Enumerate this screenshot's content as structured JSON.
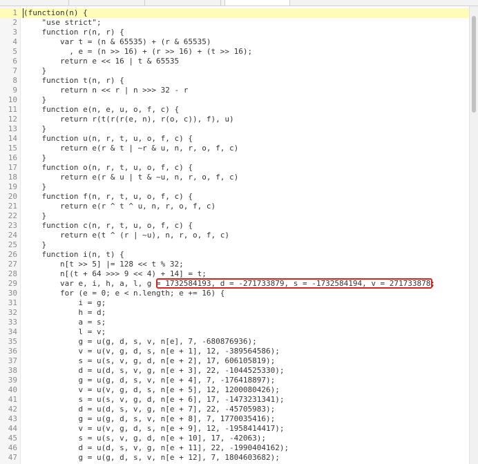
{
  "editor": {
    "current_line": 1,
    "lines": [
      {
        "n": "1",
        "text": "(function(n) {"
      },
      {
        "n": "2",
        "text": "    \"use strict\";"
      },
      {
        "n": "3",
        "text": "    function r(n, r) {"
      },
      {
        "n": "4",
        "text": "        var t = (n & 65535) + (r & 65535)"
      },
      {
        "n": "5",
        "text": "          , e = (n >> 16) + (r >> 16) + (t >> 16);"
      },
      {
        "n": "6",
        "text": "        return e << 16 | t & 65535"
      },
      {
        "n": "7",
        "text": "    }"
      },
      {
        "n": "8",
        "text": "    function t(n, r) {"
      },
      {
        "n": "9",
        "text": "        return n << r | n >>> 32 - r"
      },
      {
        "n": "10",
        "text": "    }"
      },
      {
        "n": "11",
        "text": "    function e(n, e, u, o, f, c) {"
      },
      {
        "n": "12",
        "text": "        return r(t(r(r(e, n), r(o, c)), f), u)"
      },
      {
        "n": "13",
        "text": "    }"
      },
      {
        "n": "14",
        "text": "    function u(n, r, t, u, o, f, c) {"
      },
      {
        "n": "15",
        "text": "        return e(r & t | ~r & u, n, r, o, f, c)"
      },
      {
        "n": "16",
        "text": "    }"
      },
      {
        "n": "17",
        "text": "    function o(n, r, t, u, o, f, c) {"
      },
      {
        "n": "18",
        "text": "        return e(r & u | t & ~u, n, r, o, f, c)"
      },
      {
        "n": "19",
        "text": "    }"
      },
      {
        "n": "20",
        "text": "    function f(n, r, t, u, o, f, c) {"
      },
      {
        "n": "21",
        "text": "        return e(r ^ t ^ u, n, r, o, f, c)"
      },
      {
        "n": "22",
        "text": "    }"
      },
      {
        "n": "23",
        "text": "    function c(n, r, t, u, o, f, c) {"
      },
      {
        "n": "24",
        "text": "        return e(t ^ (r | ~u), n, r, o, f, c)"
      },
      {
        "n": "25",
        "text": "    }"
      },
      {
        "n": "26",
        "text": "    function i(n, t) {"
      },
      {
        "n": "27",
        "text": "        n[t >> 5] |= 128 << t % 32;"
      },
      {
        "n": "28",
        "text": "        n[(t + 64 >>> 9 << 4) + 14] = t;"
      },
      {
        "n": "29",
        "text": "        var e, i, h, a, l, g = 1732584193, d = -271733879, s = -1732584194, v = 271733878;"
      },
      {
        "n": "30",
        "text": "        for (e = 0; e < n.length; e += 16) {"
      },
      {
        "n": "31",
        "text": "            i = g;"
      },
      {
        "n": "32",
        "text": "            h = d;"
      },
      {
        "n": "33",
        "text": "            a = s;"
      },
      {
        "n": "34",
        "text": "            l = v;"
      },
      {
        "n": "35",
        "text": "            g = u(g, d, s, v, n[e], 7, -680876936);"
      },
      {
        "n": "36",
        "text": "            v = u(v, g, d, s, n[e + 1], 12, -389564586);"
      },
      {
        "n": "37",
        "text": "            s = u(s, v, g, d, n[e + 2], 17, 606105819);"
      },
      {
        "n": "38",
        "text": "            d = u(d, s, v, g, n[e + 3], 22, -1044525330);"
      },
      {
        "n": "39",
        "text": "            g = u(g, d, s, v, n[e + 4], 7, -176418897);"
      },
      {
        "n": "40",
        "text": "            v = u(v, g, d, s, n[e + 5], 12, 1200080426);"
      },
      {
        "n": "41",
        "text": "            s = u(s, v, g, d, n[e + 6], 17, -1473231341);"
      },
      {
        "n": "42",
        "text": "            d = u(d, s, v, g, n[e + 7], 22, -45705983);"
      },
      {
        "n": "43",
        "text": "            g = u(g, d, s, v, n[e + 8], 7, 1770035416);"
      },
      {
        "n": "44",
        "text": "            v = u(v, g, d, s, n[e + 9], 12, -1958414417);"
      },
      {
        "n": "45",
        "text": "            s = u(s, v, g, d, n[e + 10], 17, -42063);"
      },
      {
        "n": "46",
        "text": "            d = u(d, s, v, g, n[e + 11], 22, -1990404162);"
      },
      {
        "n": "47",
        "text": "            g = u(g, d, s, v, n[e + 12], 7, 1804603682);"
      }
    ]
  },
  "annotation": {
    "line": 29,
    "color": "#e0201c",
    "highlighted_text": "= 1732584193, d = -271733879, s = -1732584194, v = 271733878;"
  },
  "colors": {
    "current_line_bg": "#fffbb8",
    "gutter_bg": "#f6f6f6",
    "keyword": "#1f1fa8",
    "string": "#a31515"
  }
}
